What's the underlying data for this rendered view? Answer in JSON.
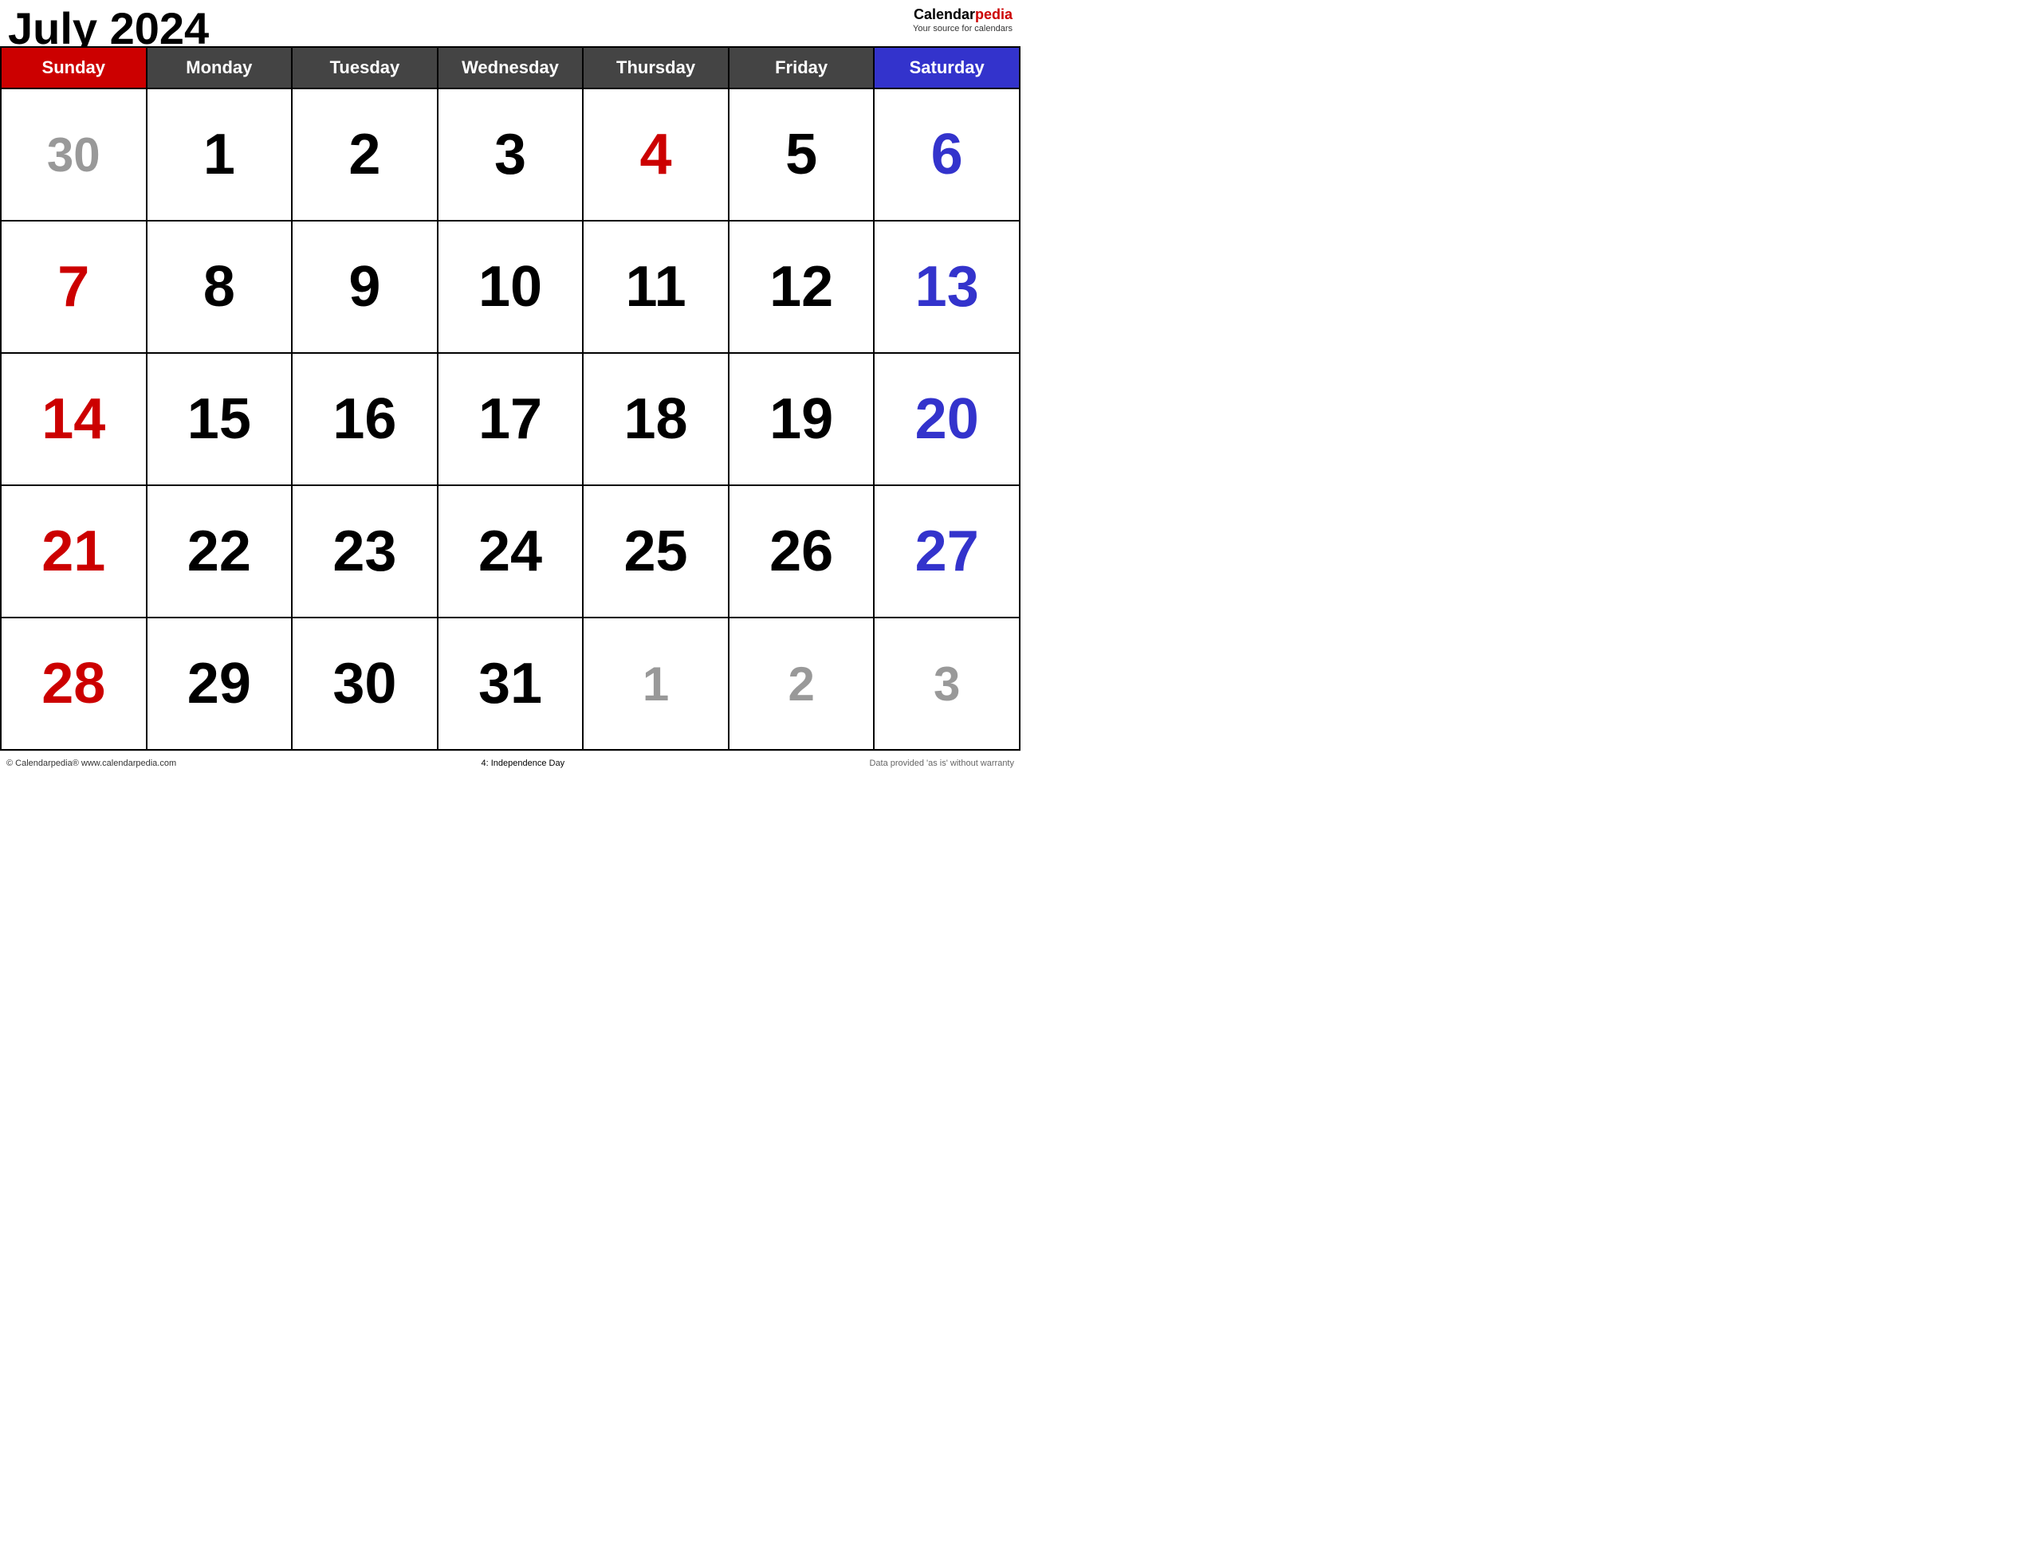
{
  "header": {
    "title": "July 2024",
    "brand": {
      "calendar_part": "Calendar",
      "pedia_part": "pedia",
      "tagline": "Your source for calendars"
    }
  },
  "day_headers": [
    {
      "label": "Sunday",
      "type": "sunday"
    },
    {
      "label": "Monday",
      "type": "weekday"
    },
    {
      "label": "Tuesday",
      "type": "weekday"
    },
    {
      "label": "Wednesday",
      "type": "weekday"
    },
    {
      "label": "Thursday",
      "type": "weekday"
    },
    {
      "label": "Friday",
      "type": "weekday"
    },
    {
      "label": "Saturday",
      "type": "saturday"
    }
  ],
  "weeks": [
    {
      "days": [
        {
          "num": "30",
          "type": "other-month"
        },
        {
          "num": "1",
          "type": "weekday-num"
        },
        {
          "num": "2",
          "type": "weekday-num"
        },
        {
          "num": "3",
          "type": "weekday-num"
        },
        {
          "num": "4",
          "type": "holiday-num"
        },
        {
          "num": "5",
          "type": "weekday-num"
        },
        {
          "num": "6",
          "type": "saturday-num"
        }
      ]
    },
    {
      "days": [
        {
          "num": "7",
          "type": "sunday-num"
        },
        {
          "num": "8",
          "type": "weekday-num"
        },
        {
          "num": "9",
          "type": "weekday-num"
        },
        {
          "num": "10",
          "type": "weekday-num"
        },
        {
          "num": "11",
          "type": "weekday-num"
        },
        {
          "num": "12",
          "type": "weekday-num"
        },
        {
          "num": "13",
          "type": "saturday-num"
        }
      ]
    },
    {
      "days": [
        {
          "num": "14",
          "type": "sunday-num"
        },
        {
          "num": "15",
          "type": "weekday-num"
        },
        {
          "num": "16",
          "type": "weekday-num"
        },
        {
          "num": "17",
          "type": "weekday-num"
        },
        {
          "num": "18",
          "type": "weekday-num"
        },
        {
          "num": "19",
          "type": "weekday-num"
        },
        {
          "num": "20",
          "type": "saturday-num"
        }
      ]
    },
    {
      "days": [
        {
          "num": "21",
          "type": "sunday-num"
        },
        {
          "num": "22",
          "type": "weekday-num"
        },
        {
          "num": "23",
          "type": "weekday-num"
        },
        {
          "num": "24",
          "type": "weekday-num"
        },
        {
          "num": "25",
          "type": "weekday-num"
        },
        {
          "num": "26",
          "type": "weekday-num"
        },
        {
          "num": "27",
          "type": "saturday-num"
        }
      ]
    },
    {
      "days": [
        {
          "num": "28",
          "type": "sunday-num"
        },
        {
          "num": "29",
          "type": "weekday-num"
        },
        {
          "num": "30",
          "type": "weekday-num"
        },
        {
          "num": "31",
          "type": "weekday-num"
        },
        {
          "num": "1",
          "type": "other-month"
        },
        {
          "num": "2",
          "type": "other-month"
        },
        {
          "num": "3",
          "type": "other-month"
        }
      ]
    }
  ],
  "footer": {
    "copyright": "© Calendarpedia®  www.calendarpedia.com",
    "holiday_note": "4: Independence Day",
    "disclaimer": "Data provided 'as is' without warranty"
  }
}
